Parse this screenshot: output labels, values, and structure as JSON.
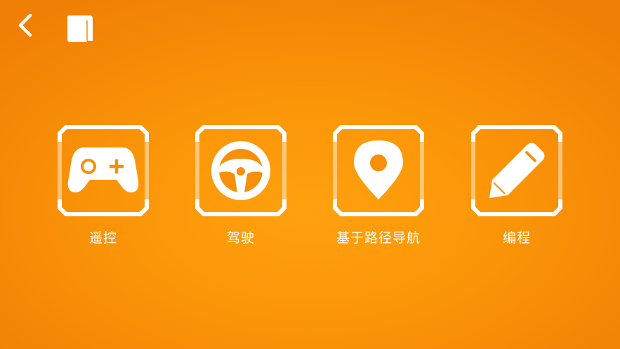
{
  "header": {
    "back_icon": "chevron-left-icon",
    "manual_icon": "book-icon"
  },
  "modes": [
    {
      "id": "remote",
      "label": "遥控",
      "icon": "gamepad-icon"
    },
    {
      "id": "drive",
      "label": "驾驶",
      "icon": "steering-wheel-icon"
    },
    {
      "id": "navigate",
      "label": "基于路径导航",
      "icon": "map-pin-icon"
    },
    {
      "id": "program",
      "label": "编程",
      "icon": "pencil-icon"
    }
  ],
  "colors": {
    "background_center": "#ffa10e",
    "background_edge": "#f07f05",
    "foreground": "#ffffff"
  }
}
